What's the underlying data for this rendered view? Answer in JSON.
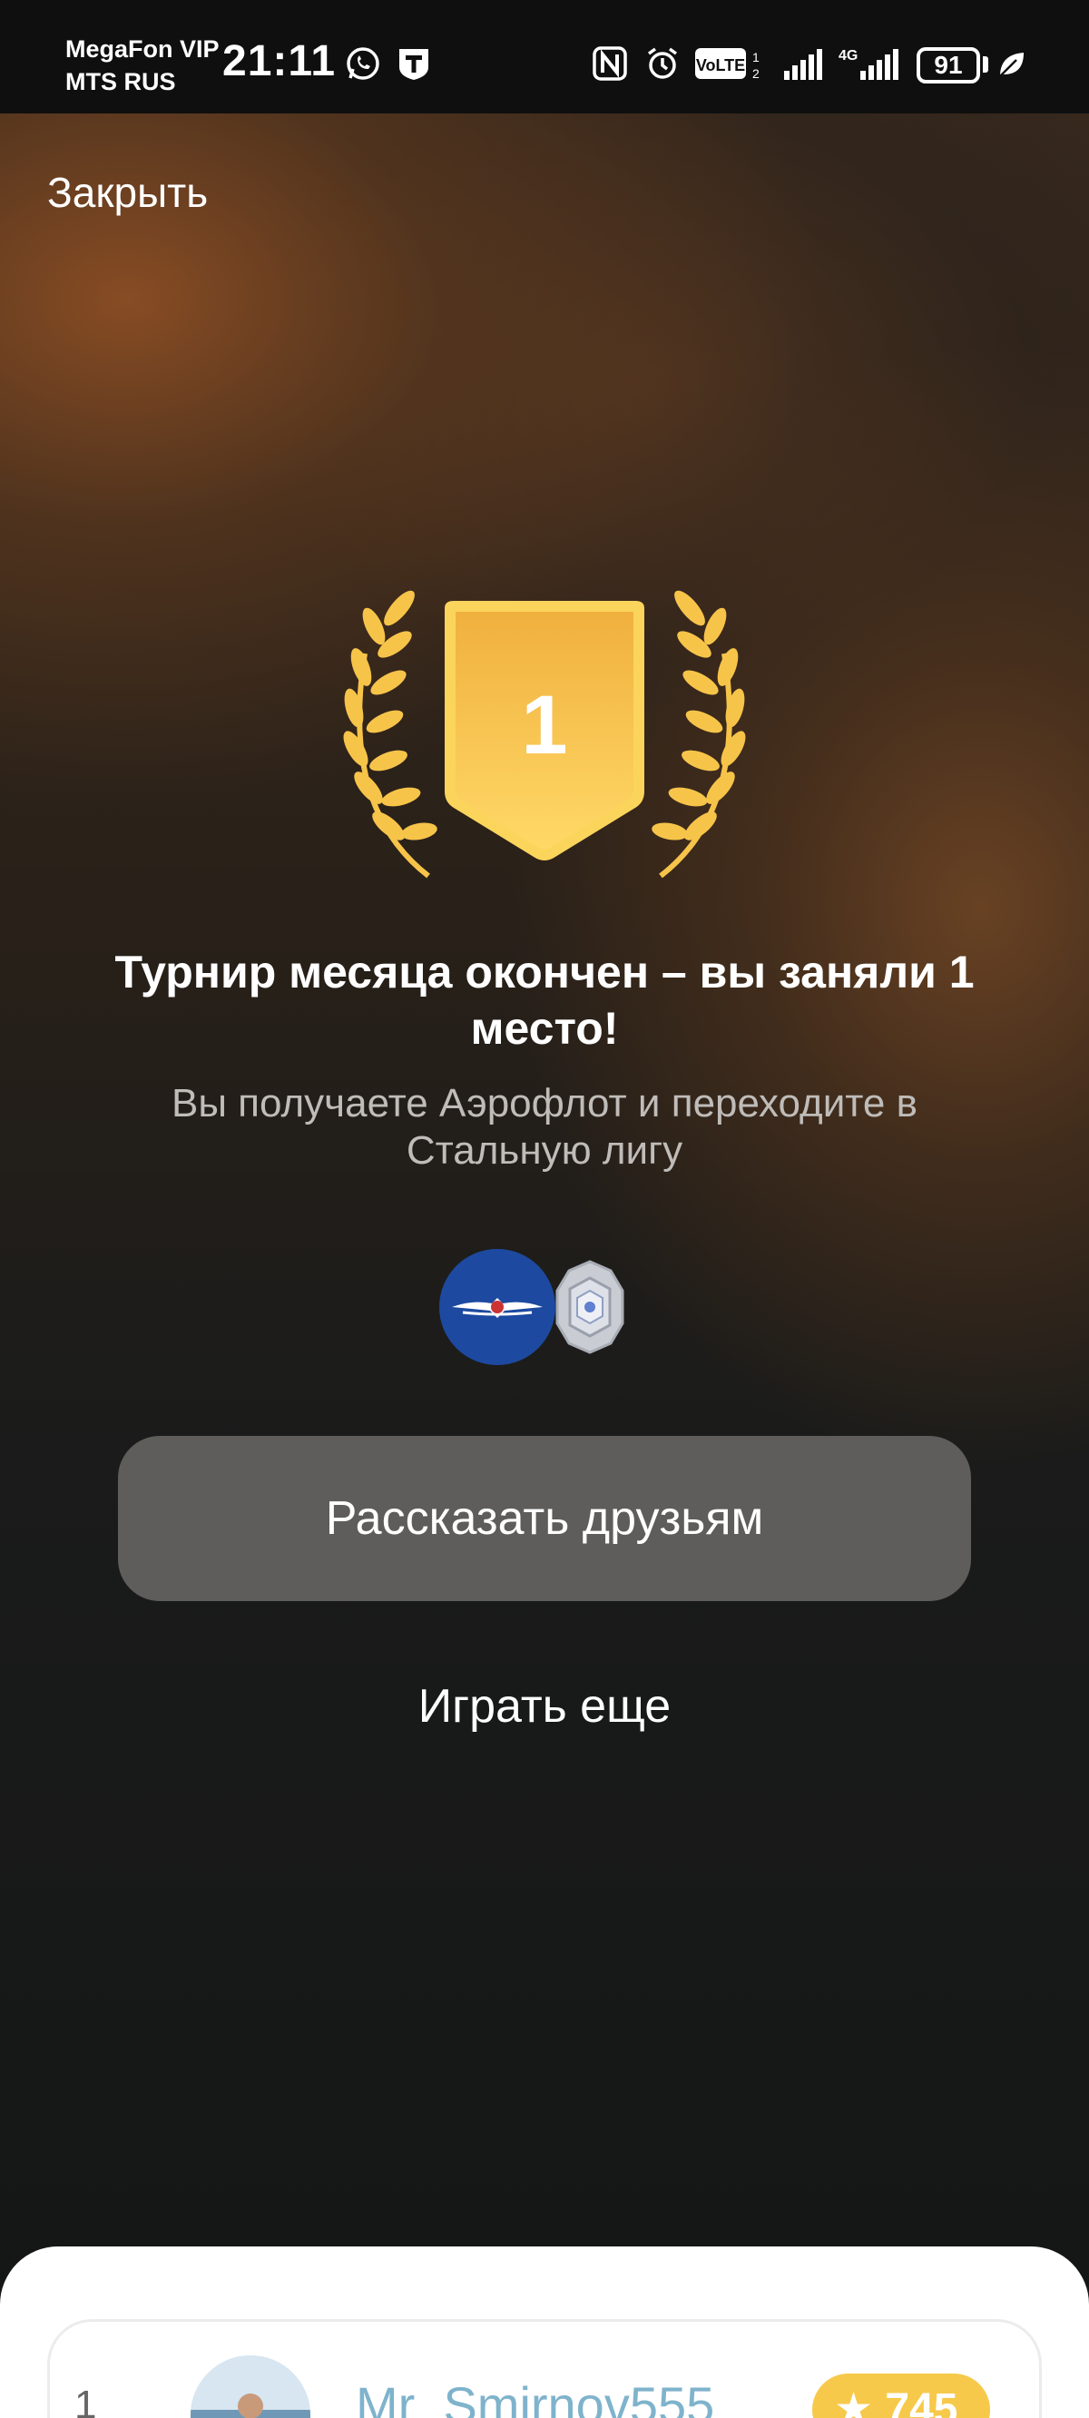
{
  "status_bar": {
    "carrier_primary": "MegaFon VIP",
    "carrier_secondary": "MTS RUS",
    "time": "21:11",
    "network": "4G",
    "volte": "VoLTE",
    "battery": "91",
    "icons": [
      "whatsapp-icon",
      "t-app-icon",
      "nfc-icon",
      "alarm-icon",
      "volte-icon",
      "signal-icon",
      "battery-icon",
      "leaf-icon"
    ]
  },
  "header": {
    "close_label": "Закрыть"
  },
  "result": {
    "place_number": "1",
    "title": "Турнир месяца окончен – вы заняли 1 место!",
    "subtitle": "Вы получаете Аэрофлот и переходите в Стальную лигу",
    "reward_icons": [
      "aeroflot-logo-icon",
      "steel-league-icon"
    ]
  },
  "actions": {
    "share_label": "Рассказать друзьям",
    "play_again_label": "Играть еще"
  },
  "leaderboard": {
    "rows": [
      {
        "rank": "1",
        "username": "Mr_Smirnov555",
        "score": "745"
      }
    ]
  },
  "colors": {
    "gold": "#F5B93A",
    "share_button_bg": "#5E5D5B",
    "aeroflot_blue": "#1D4AA0",
    "score_badge": "#F7C94A",
    "username_link": "#7FB3CC"
  }
}
